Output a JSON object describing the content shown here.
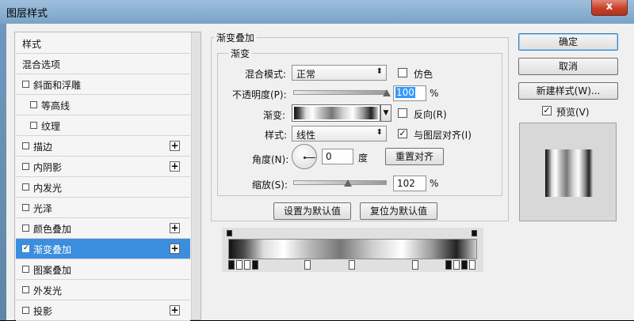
{
  "window": {
    "title": "图层样式",
    "close_label": "x"
  },
  "styles_list": {
    "items": [
      {
        "label": "样式",
        "checkbox": false,
        "checked": false,
        "indent": 0,
        "plus": false,
        "selected": false
      },
      {
        "label": "混合选项",
        "checkbox": false,
        "checked": false,
        "indent": 0,
        "plus": false,
        "selected": false
      },
      {
        "label": "斜面和浮雕",
        "checkbox": true,
        "checked": false,
        "indent": 0,
        "plus": false,
        "selected": false
      },
      {
        "label": "等高线",
        "checkbox": true,
        "checked": false,
        "indent": 1,
        "plus": false,
        "selected": false
      },
      {
        "label": "纹理",
        "checkbox": true,
        "checked": false,
        "indent": 1,
        "plus": false,
        "selected": false
      },
      {
        "label": "描边",
        "checkbox": true,
        "checked": false,
        "indent": 0,
        "plus": true,
        "selected": false
      },
      {
        "label": "内阴影",
        "checkbox": true,
        "checked": false,
        "indent": 0,
        "plus": true,
        "selected": false
      },
      {
        "label": "内发光",
        "checkbox": true,
        "checked": false,
        "indent": 0,
        "plus": false,
        "selected": false
      },
      {
        "label": "光泽",
        "checkbox": true,
        "checked": false,
        "indent": 0,
        "plus": false,
        "selected": false
      },
      {
        "label": "颜色叠加",
        "checkbox": true,
        "checked": false,
        "indent": 0,
        "plus": true,
        "selected": false
      },
      {
        "label": "渐变叠加",
        "checkbox": true,
        "checked": true,
        "indent": 0,
        "plus": true,
        "selected": true
      },
      {
        "label": "图案叠加",
        "checkbox": true,
        "checked": false,
        "indent": 0,
        "plus": false,
        "selected": false
      },
      {
        "label": "外发光",
        "checkbox": true,
        "checked": false,
        "indent": 0,
        "plus": false,
        "selected": false
      },
      {
        "label": "投影",
        "checkbox": true,
        "checked": false,
        "indent": 0,
        "plus": true,
        "selected": false
      }
    ]
  },
  "gradient_overlay": {
    "section_title": "渐变叠加",
    "group_title": "渐变",
    "blend_mode": {
      "label": "混合模式:",
      "value": "正常"
    },
    "dither": {
      "label": "仿色",
      "checked": false
    },
    "opacity": {
      "label": "不透明度(P):",
      "value": "100",
      "unit": "%",
      "fraction": 1.0
    },
    "gradient": {
      "label": "渐变:"
    },
    "reverse": {
      "label": "反向(R)",
      "checked": false
    },
    "style": {
      "label": "样式:",
      "value": "线性"
    },
    "align_with_layer": {
      "label": "与图层对齐(I)",
      "checked": true
    },
    "angle": {
      "label": "角度(N):",
      "value": "0",
      "unit": "度"
    },
    "reset_alignment_label": "重置对齐",
    "scale": {
      "label": "缩放(S):",
      "value": "102",
      "unit": "%"
    },
    "make_default_label": "设置为默认值",
    "reset_default_label": "复位为默认值"
  },
  "actions": {
    "ok_label": "确定",
    "cancel_label": "取消",
    "new_style_label": "新建样式(W)...",
    "preview": {
      "label": "预览(V)",
      "checked": true
    }
  }
}
